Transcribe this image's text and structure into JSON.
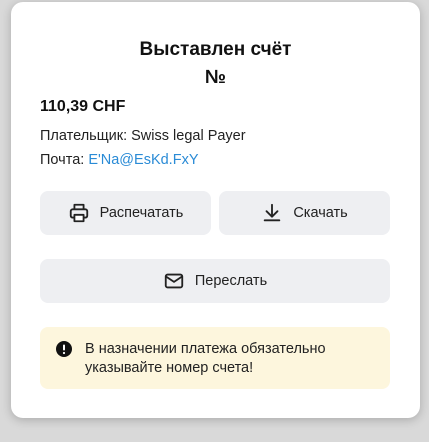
{
  "invoice": {
    "title_line1": "Выставлен счёт",
    "title_line2": "№",
    "amount": "110,39 CHF",
    "payer_label": "Плательщик:",
    "payer_name": "Swiss legal Payer",
    "email_label": "Почта:",
    "email_value": "E'Na@EsKd.FxY"
  },
  "actions": {
    "print_label": "Распечатать",
    "download_label": "Скачать",
    "forward_label": "Переслать"
  },
  "notice": {
    "text": "В назначении платежа обязательно указывайте номер счета!"
  },
  "icons": {
    "print": "printer-icon",
    "download": "download-icon",
    "forward": "mail-icon",
    "notice": "exclamation-circle-icon"
  },
  "colors": {
    "link": "#2a8bd6",
    "button_bg": "#eeeff2",
    "notice_bg": "#fdf6dd"
  }
}
